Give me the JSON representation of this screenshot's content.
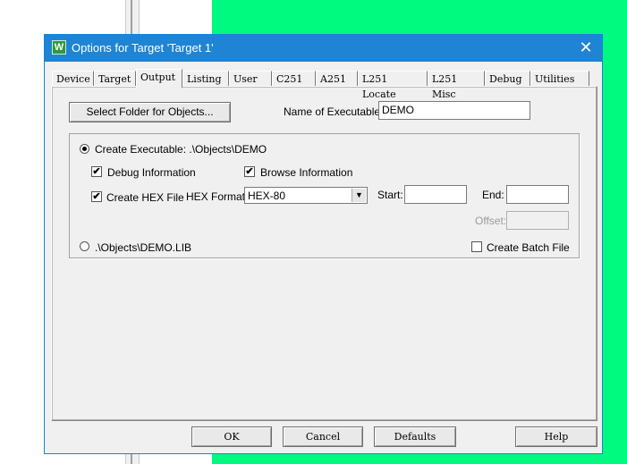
{
  "window": {
    "title": "Options for Target 'Target 1'",
    "icon_letter": "W",
    "close_glyph": "✕"
  },
  "tabs": [
    {
      "label": "Device"
    },
    {
      "label": "Target"
    },
    {
      "label": "Output"
    },
    {
      "label": "Listing"
    },
    {
      "label": "User"
    },
    {
      "label": "C251"
    },
    {
      "label": "A251"
    },
    {
      "label": "L251 Locate"
    },
    {
      "label": "L251 Misc"
    },
    {
      "label": "Debug"
    },
    {
      "label": "Utilities"
    }
  ],
  "active_tab": "Output",
  "output": {
    "select_folder_label": "Select Folder for Objects...",
    "name_label": "Name of Executable:",
    "name_value": "DEMO",
    "create_exe_label": "Create Executable:  .\\Objects\\DEMO",
    "debug_info_label": "Debug Information",
    "browse_info_label": "Browse Information",
    "create_hex_label": "Create HEX File",
    "hex_format_label": "HEX Format:",
    "hex_format_value": "HEX-80",
    "start_label": "Start:",
    "start_value": "",
    "end_label": "End:",
    "end_value": "",
    "offset_label": "Offset:",
    "offset_value": "",
    "create_lib_label": ".\\Objects\\DEMO.LIB",
    "batch_label": "Create Batch File",
    "check_glyph": "✔",
    "arrow_glyph": "▼"
  },
  "buttons": {
    "ok": "OK",
    "cancel": "Cancel",
    "defaults": "Defaults",
    "help": "Help"
  }
}
